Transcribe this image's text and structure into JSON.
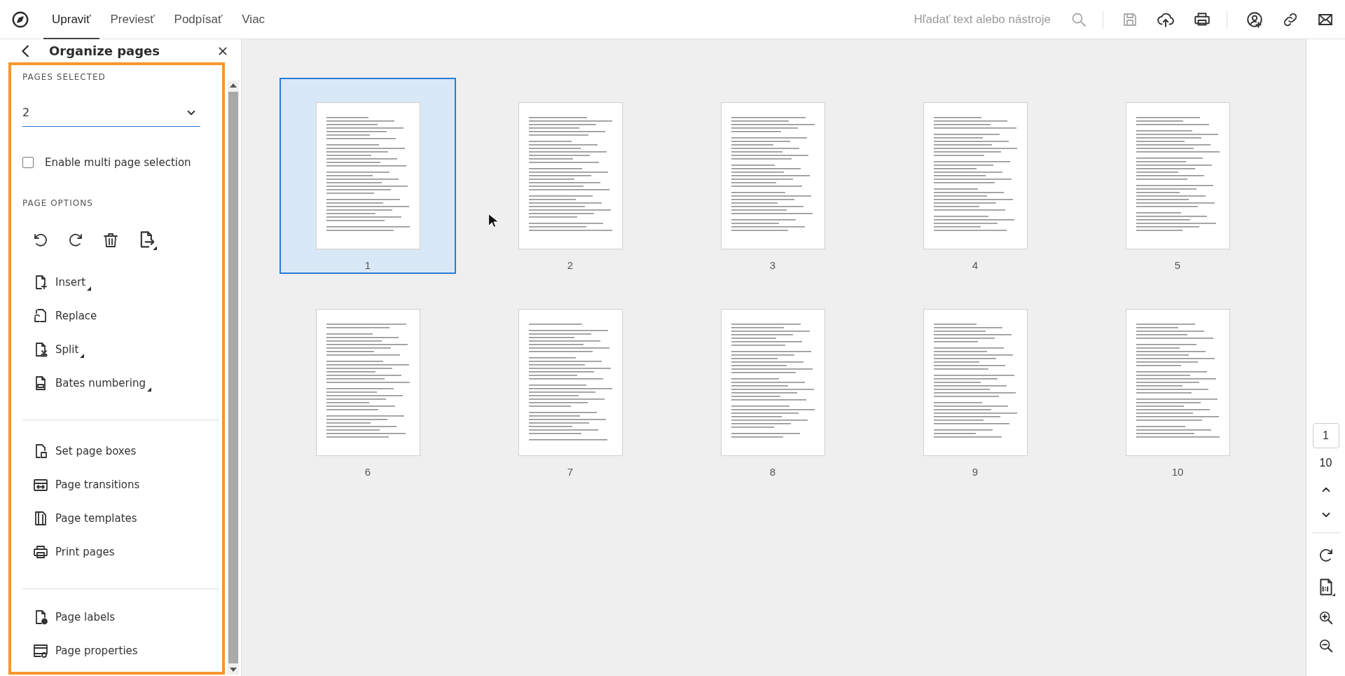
{
  "toolbar": {
    "tabs": [
      {
        "label": "Upraviť",
        "selected": true
      },
      {
        "label": "Previesť",
        "selected": false
      },
      {
        "label": "Podpísať",
        "selected": false
      },
      {
        "label": "Viac",
        "selected": false
      }
    ],
    "search": {
      "placeholder": "Hľadať text alebo nástroje"
    }
  },
  "panel": {
    "title": "Organize pages",
    "pages_selected": {
      "label": "PAGES SELECTED",
      "value": "2"
    },
    "multi_page": {
      "label": "Enable multi page selection",
      "checked": false
    },
    "page_options_label": "PAGE OPTIONS",
    "menu_groups": [
      {
        "items": [
          {
            "label": "Insert",
            "submenu": true
          },
          {
            "label": "Replace",
            "submenu": false
          },
          {
            "label": "Split",
            "submenu": true
          },
          {
            "label": "Bates numbering",
            "submenu": true
          }
        ]
      },
      {
        "items": [
          {
            "label": "Set page boxes",
            "submenu": false
          },
          {
            "label": "Page transitions",
            "submenu": false
          },
          {
            "label": "Page templates",
            "submenu": false
          },
          {
            "label": "Print pages",
            "submenu": false
          }
        ]
      },
      {
        "items": [
          {
            "label": "Page labels",
            "submenu": false
          },
          {
            "label": "Page properties",
            "submenu": false
          }
        ]
      }
    ]
  },
  "pages": [
    {
      "label": "1",
      "selected": true
    },
    {
      "label": "2",
      "selected": false
    },
    {
      "label": "3",
      "selected": false
    },
    {
      "label": "4",
      "selected": false
    },
    {
      "label": "5",
      "selected": false
    },
    {
      "label": "6",
      "selected": false
    },
    {
      "label": "7",
      "selected": false
    },
    {
      "label": "8",
      "selected": false
    },
    {
      "label": "9",
      "selected": false
    },
    {
      "label": "10",
      "selected": false
    }
  ],
  "navigator": {
    "current_page": "1",
    "total_pages": "10"
  }
}
